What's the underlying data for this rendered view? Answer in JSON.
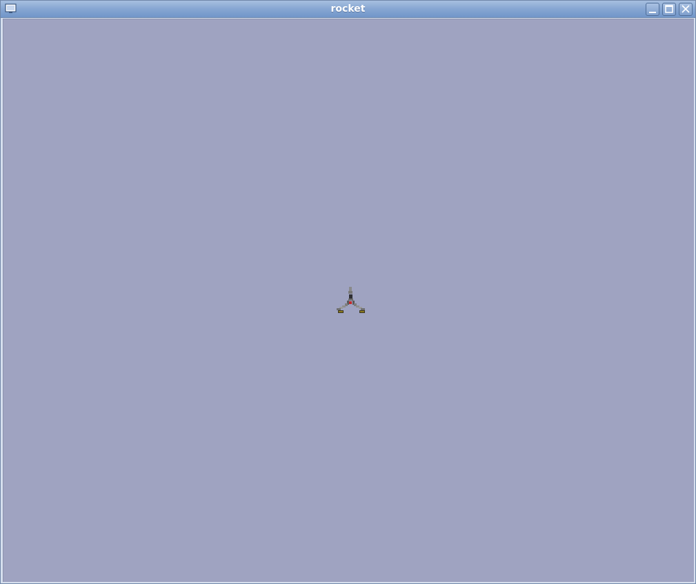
{
  "window": {
    "title": "rocket",
    "controls": {
      "minimize": "minimize-icon",
      "maximize": "maximize-icon",
      "close": "close-icon"
    }
  },
  "game": {
    "background_color": "#9fa3c1",
    "sprite": "rocket-ship-icon"
  }
}
